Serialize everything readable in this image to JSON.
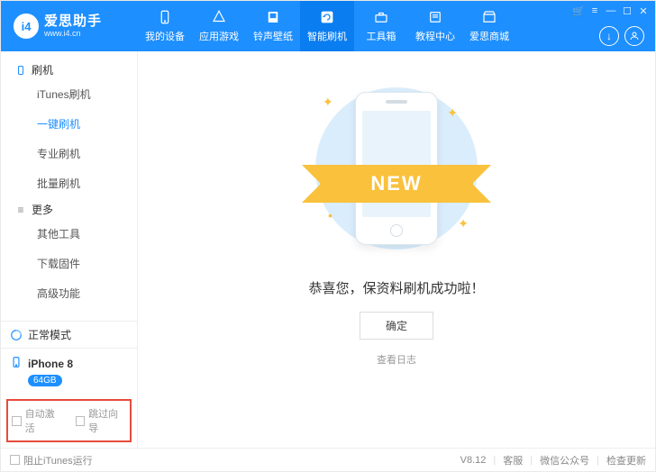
{
  "brand": {
    "name": "爱思助手",
    "url": "www.i4.cn",
    "logo_text": "i4"
  },
  "nav": [
    {
      "label": "我的设备",
      "icon": "device"
    },
    {
      "label": "应用游戏",
      "icon": "apps"
    },
    {
      "label": "铃声壁纸",
      "icon": "media"
    },
    {
      "label": "智能刷机",
      "icon": "flash",
      "active": true
    },
    {
      "label": "工具箱",
      "icon": "toolbox"
    },
    {
      "label": "教程中心",
      "icon": "doc"
    },
    {
      "label": "爱思商城",
      "icon": "shop"
    }
  ],
  "sidebar": {
    "groups": [
      {
        "title": "刷机",
        "icon": "phone",
        "items": [
          "iTunes刷机",
          "一键刷机",
          "专业刷机",
          "批量刷机"
        ],
        "active_index": 1
      },
      {
        "title": "更多",
        "icon": "menu",
        "items": [
          "其他工具",
          "下载固件",
          "高级功能"
        ],
        "active_index": -1
      }
    ],
    "status": {
      "text": "正常模式"
    },
    "device": {
      "name": "iPhone 8",
      "storage": "64GB"
    },
    "checks": {
      "auto_activate": "自动激活",
      "skip_guide": "跳过向导"
    }
  },
  "main": {
    "ribbon": "NEW",
    "success_text": "恭喜您，保资料刷机成功啦！",
    "ok_button": "确定",
    "log_link": "查看日志"
  },
  "footer": {
    "block_itunes": "阻止iTunes运行",
    "version": "V8.12",
    "support": "客服",
    "wechat": "微信公众号",
    "update": "检查更新"
  }
}
